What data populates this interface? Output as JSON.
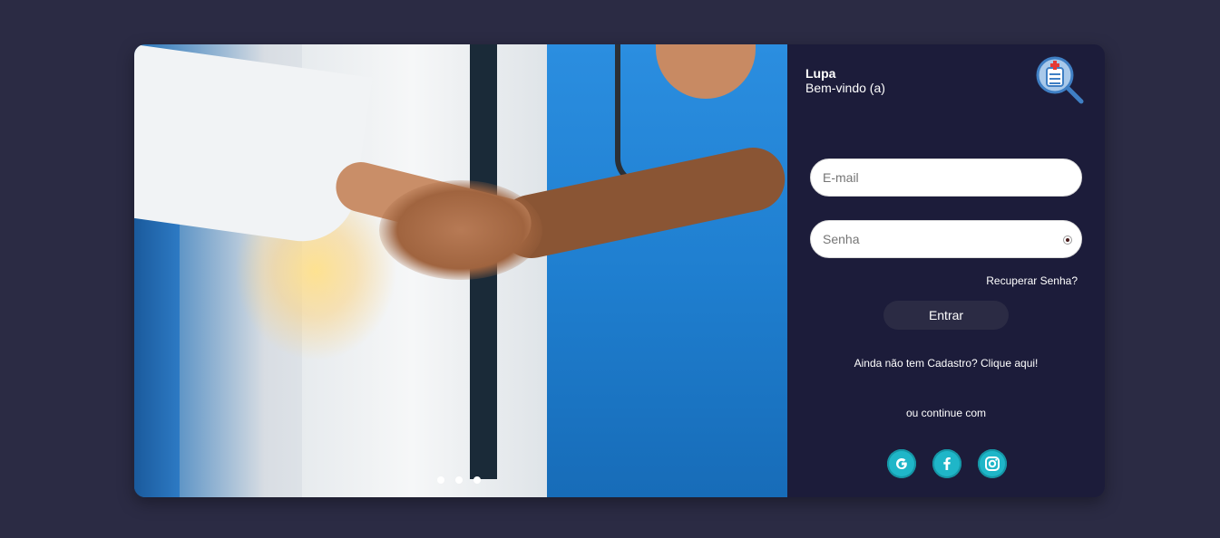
{
  "brand": {
    "name": "Lupa",
    "welcome": "Bem-vindo (a)"
  },
  "form": {
    "email_placeholder": "E-mail",
    "email_value": "",
    "password_placeholder": "Senha",
    "password_value": "",
    "recover_label": "Recuperar Senha?",
    "submit_label": "Entrar",
    "signup_label": "Ainda não tem Cadastro? Clique aqui!",
    "continue_label": "ou continue com"
  },
  "social": [
    {
      "icon": "google-icon"
    },
    {
      "icon": "facebook-icon"
    },
    {
      "icon": "instagram-icon"
    }
  ],
  "carousel": {
    "slide_count": 3
  },
  "colors": {
    "background": "#2b2b44",
    "panel": "#1c1c3a",
    "social": "#1fb6c8",
    "button": "#2b2b44"
  }
}
